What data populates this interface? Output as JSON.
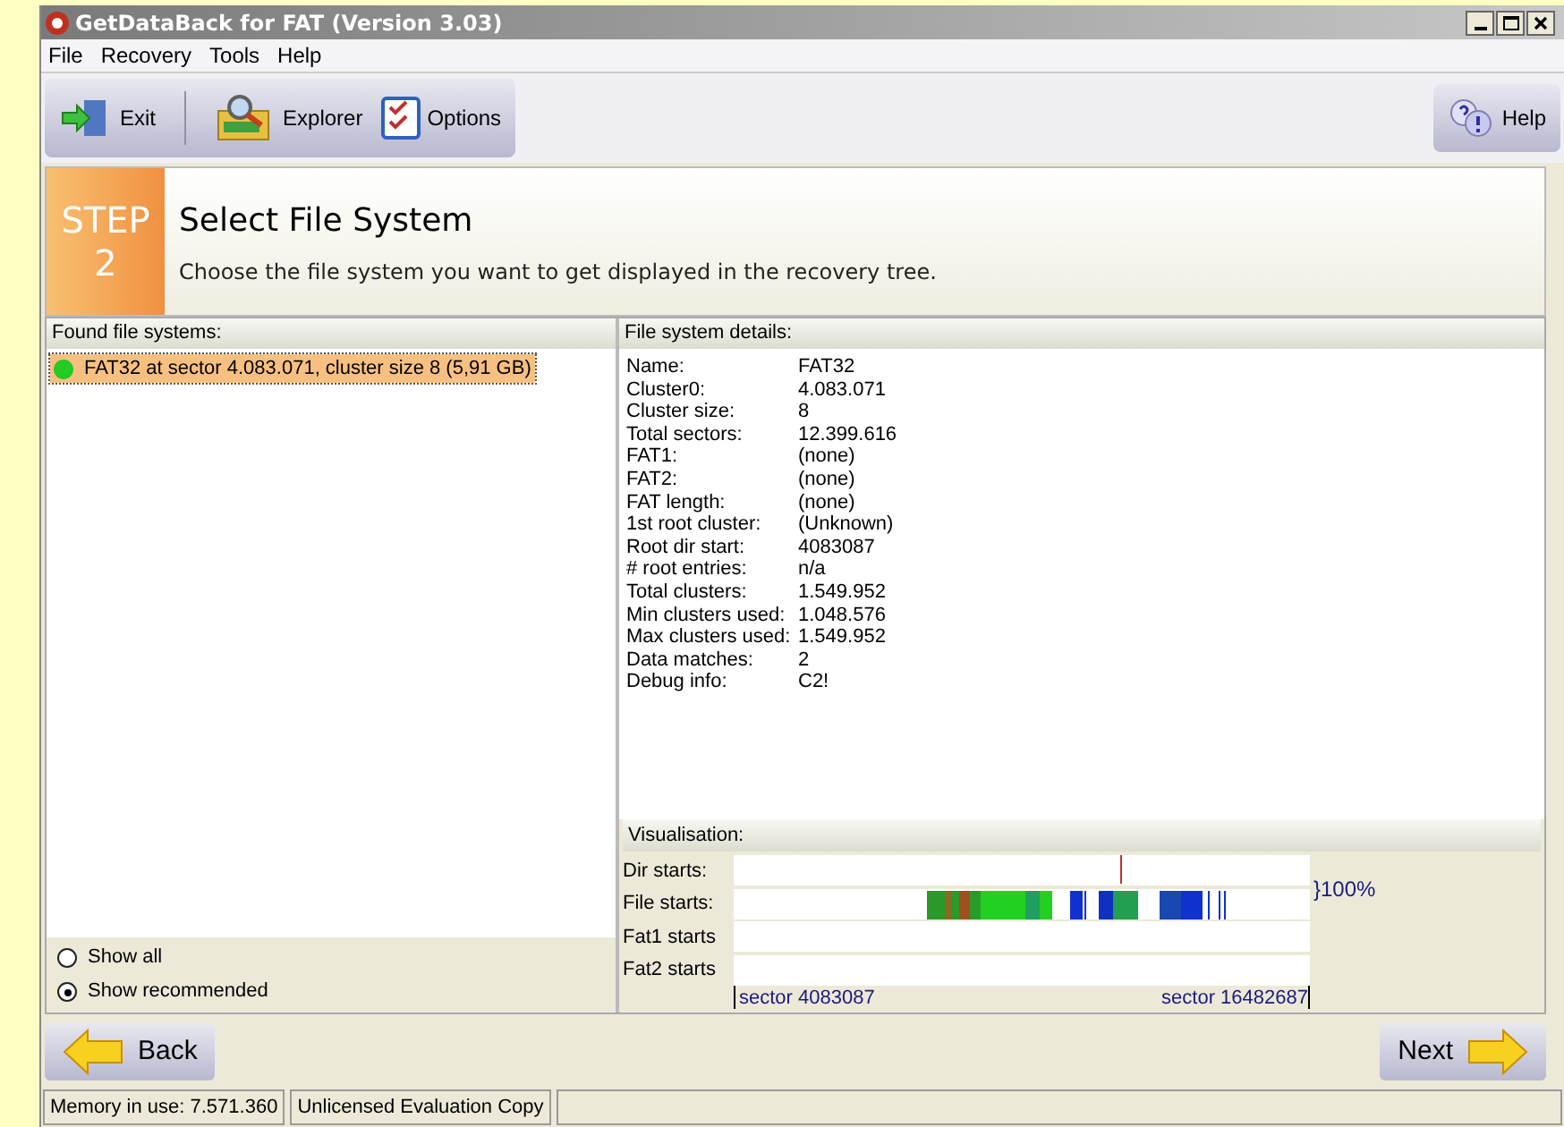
{
  "window": {
    "title": "GetDataBack for FAT (Version 3.03)"
  },
  "menu": [
    "File",
    "Recovery",
    "Tools",
    "Help"
  ],
  "toolbar": {
    "left": [
      {
        "kind": "exit",
        "label": "Exit"
      },
      {
        "kind": "explorer",
        "label": "Explorer"
      },
      {
        "kind": "options",
        "label": "Options"
      }
    ],
    "right": [
      {
        "kind": "help",
        "label": "Help"
      }
    ]
  },
  "step": {
    "word": "STEP",
    "number": "2",
    "title": "Select File System",
    "description": "Choose the file system you want to get displayed in the recovery tree."
  },
  "found": {
    "header": "Found file systems:",
    "items": [
      {
        "label": "FAT32 at sector 4.083.071, cluster size 8 (5,91 GB)",
        "color": "#22cc22",
        "selected": true
      }
    ],
    "filters": [
      {
        "label": "Show all",
        "selected": false
      },
      {
        "label": "Show recommended",
        "selected": true
      }
    ]
  },
  "details": {
    "header": "File system details:",
    "rows": [
      {
        "label": "Name:",
        "value": "FAT32"
      },
      {
        "label": "Cluster0:",
        "value": "4.083.071"
      },
      {
        "label": "Cluster size:",
        "value": "8"
      },
      {
        "label": "Total sectors:",
        "value": "12.399.616"
      },
      {
        "label": "FAT1:",
        "value": "(none)"
      },
      {
        "label": "FAT2:",
        "value": "(none)"
      },
      {
        "label": "FAT length:",
        "value": "(none)"
      },
      {
        "label": "1st root cluster:",
        "value": "(Unknown)"
      },
      {
        "label": "Root dir start:",
        "value": "4083087"
      },
      {
        "label": "# root entries:",
        "value": "n/a"
      },
      {
        "label": "Total clusters:",
        "value": "1.549.952"
      },
      {
        "label": "Min clusters used:",
        "value": "1.048.576"
      },
      {
        "label": "Max clusters used:",
        "value": "1.549.952"
      },
      {
        "label": "Data matches:",
        "value": "2"
      },
      {
        "label": "Debug info:",
        "value": "C2!"
      }
    ]
  },
  "visualisation": {
    "header": "Visualisation:",
    "rows": [
      {
        "kind": "dir",
        "label": "Dir starts:"
      },
      {
        "kind": "file",
        "label": "File starts:"
      },
      {
        "kind": "empty",
        "label": "Fat1 starts"
      },
      {
        "kind": "empty",
        "label": "Fat2 starts"
      }
    ],
    "percent": "}100%",
    "start_label": "sector 4083087",
    "end_label": "sector 16482687"
  },
  "navigation": {
    "back": "Back",
    "next": "Next"
  },
  "status_bar": [
    "Memory in use: 7.571.360",
    "Unlicensed Evaluation Copy"
  ]
}
